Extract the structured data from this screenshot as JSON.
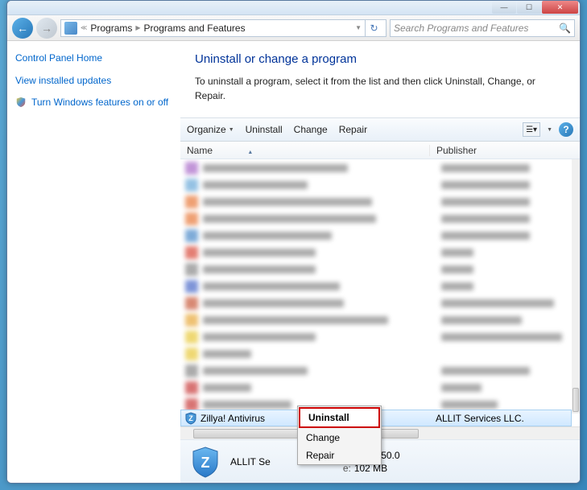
{
  "titlebar": {},
  "breadcrumb": {
    "item1": "Programs",
    "item2": "Programs and Features"
  },
  "search": {
    "placeholder": "Search Programs and Features"
  },
  "sidebar": {
    "home": "Control Panel Home",
    "updates": "View installed updates",
    "features": "Turn Windows features on or off"
  },
  "content": {
    "heading": "Uninstall or change a program",
    "description": "To uninstall a program, select it from the list and then click Uninstall, Change, or Repair."
  },
  "toolbar": {
    "organize": "Organize",
    "uninstall": "Uninstall",
    "change": "Change",
    "repair": "Repair"
  },
  "columns": {
    "name": "Name",
    "publisher": "Publisher"
  },
  "selected": {
    "name": "Zillya! Antivirus",
    "publisher": "ALLIT Services LLC."
  },
  "context_menu": {
    "uninstall": "Uninstall",
    "change": "Change",
    "repair": "Repair"
  },
  "details": {
    "publisher_label": "ALLIT Se",
    "version_label": "n:",
    "version_value": "1.1.3450.0",
    "size_label": "e:",
    "size_value": "102 MB"
  }
}
